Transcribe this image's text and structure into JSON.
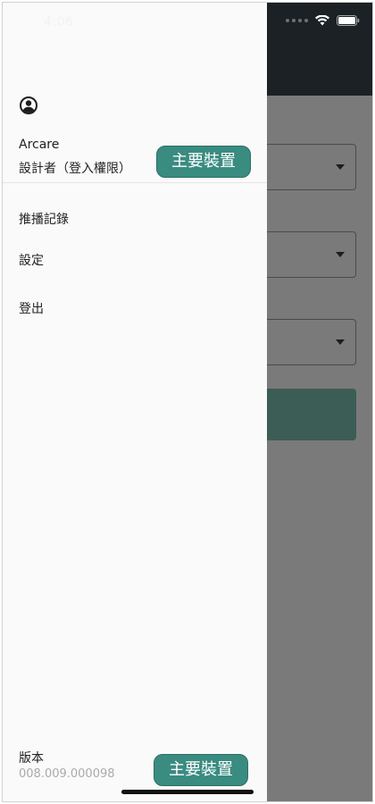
{
  "status_bar": {
    "time": "4:06"
  },
  "drawer": {
    "user": {
      "name": "Arcare",
      "role": "設計者（登入權限）"
    },
    "menu": [
      {
        "label": "推播記錄"
      },
      {
        "label": "設定"
      },
      {
        "label": "登出"
      }
    ],
    "version": {
      "label": "版本",
      "number": "008.009.000098"
    }
  },
  "badges": {
    "top": "主要裝置",
    "bottom": "主要裝置"
  },
  "colors": {
    "accent": "#3a8b80",
    "header": "#1b2124",
    "overlay": "#7a7a7a"
  }
}
